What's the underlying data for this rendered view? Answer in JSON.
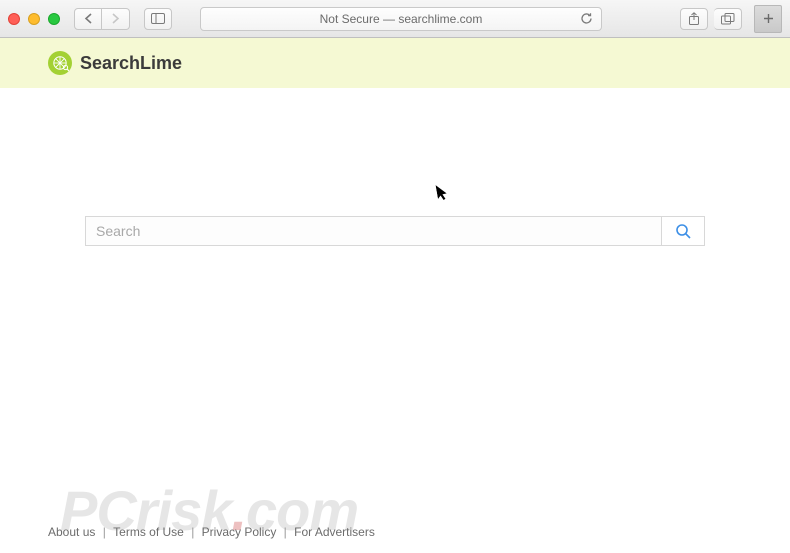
{
  "browser": {
    "address_text": "Not Secure — searchlime.com"
  },
  "brand": {
    "name": "SearchLime"
  },
  "search": {
    "placeholder": "Search",
    "value": ""
  },
  "footer": {
    "links": [
      "About us",
      "Terms of Use",
      "Privacy Policy",
      "For Advertisers"
    ],
    "sep": " | "
  },
  "watermark": {
    "prefix": "PC",
    "rest": "risk",
    "tld": "com"
  }
}
